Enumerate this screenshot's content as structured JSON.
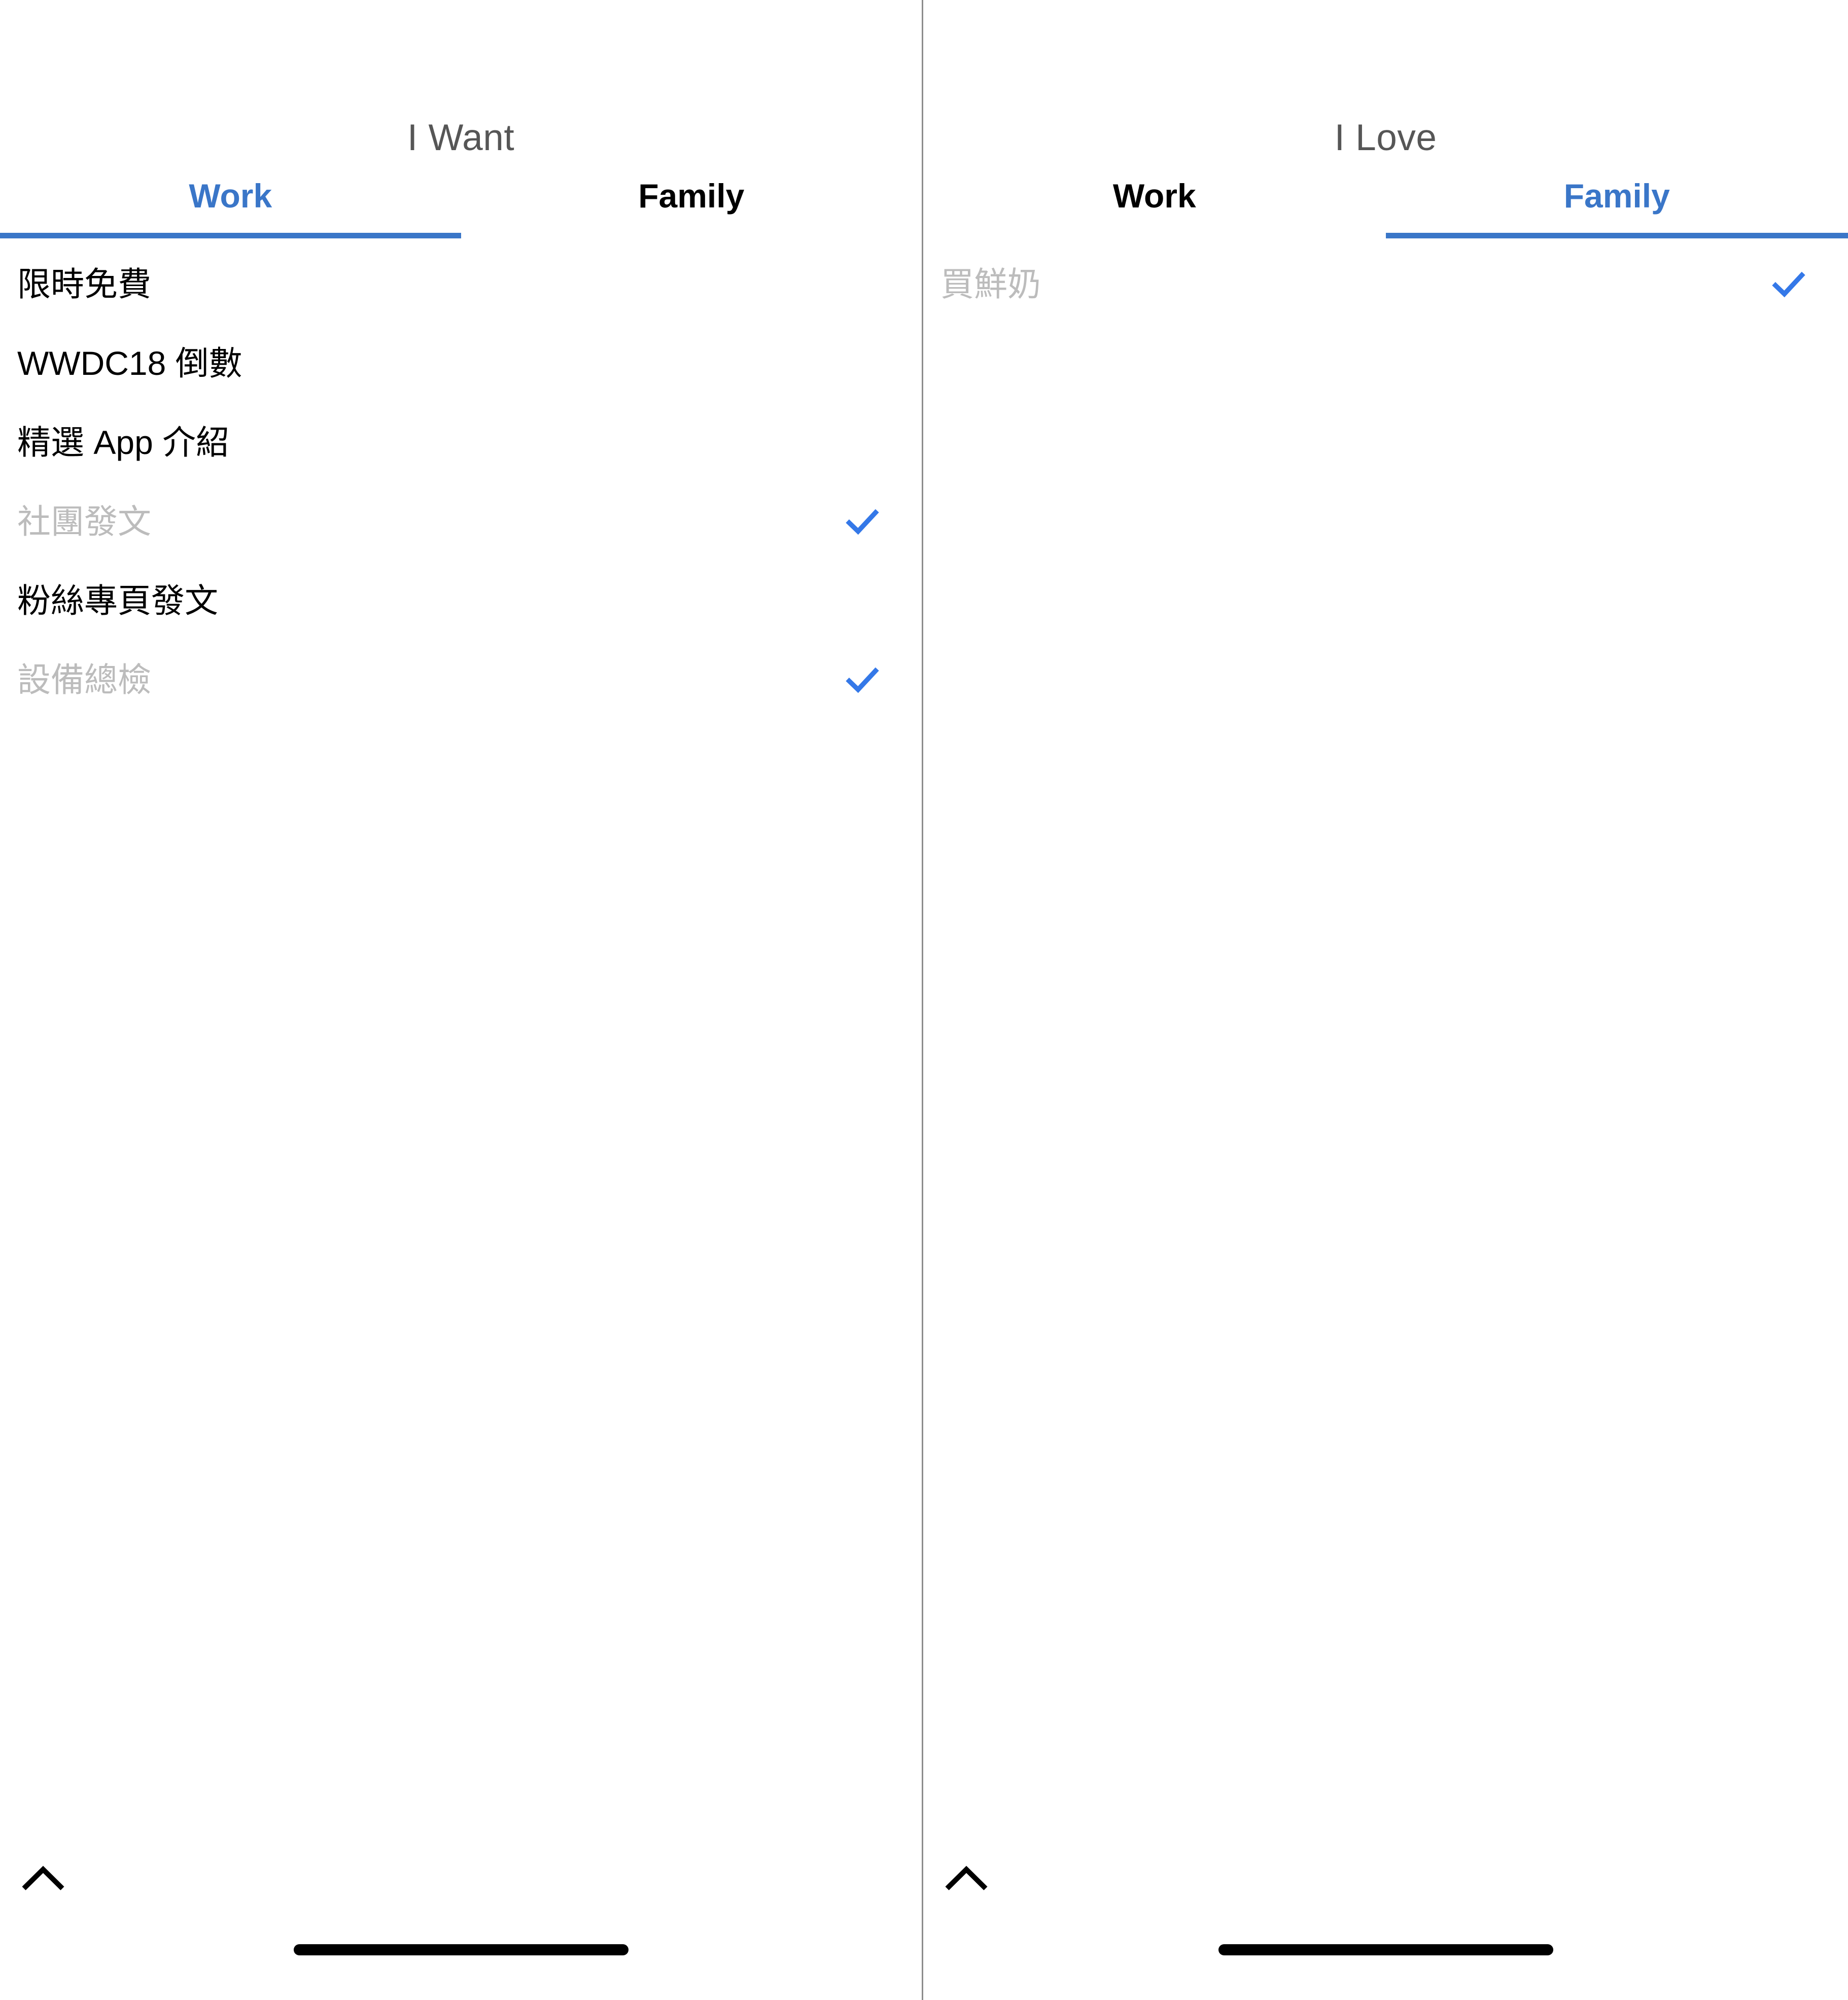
{
  "accent_color": "#3a76c8",
  "check_color": "#3478e8",
  "disabled_text_color": "#bcbcbc",
  "title_color": "#565656",
  "panels": [
    {
      "id": "left",
      "nav_title": "I Want",
      "tabs": [
        {
          "label": "Work",
          "active": true
        },
        {
          "label": "Family",
          "active": false
        }
      ],
      "active_tab_index": 0,
      "items": [
        {
          "label": "限時免費",
          "done": false
        },
        {
          "label": "WWDC18 倒數",
          "done": false
        },
        {
          "label": "精選 App 介紹",
          "done": false
        },
        {
          "label": "社團發文",
          "done": true
        },
        {
          "label": "粉絲專頁發文",
          "done": false
        },
        {
          "label": "設備總檢",
          "done": true
        }
      ],
      "collapse_icon": "chevron-up-icon"
    },
    {
      "id": "right",
      "nav_title": "I Love",
      "tabs": [
        {
          "label": "Work",
          "active": false
        },
        {
          "label": "Family",
          "active": true
        }
      ],
      "active_tab_index": 1,
      "items": [
        {
          "label": "買鮮奶",
          "done": true
        }
      ],
      "collapse_icon": "chevron-up-icon"
    }
  ]
}
